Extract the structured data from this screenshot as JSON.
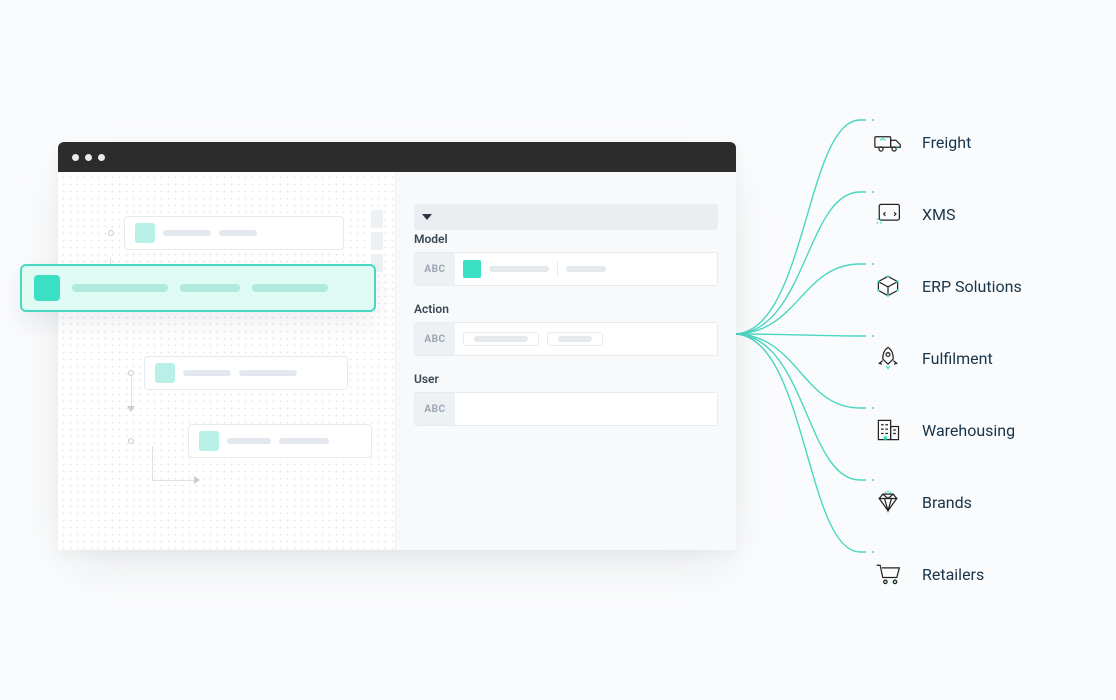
{
  "form": {
    "field1_label": "Model",
    "field2_label": "Action",
    "field3_label": "User",
    "type_badge": "ABC"
  },
  "destinations": [
    {
      "label": "Freight"
    },
    {
      "label": "XMS"
    },
    {
      "label": "ERP Solutions"
    },
    {
      "label": "Fulfilment"
    },
    {
      "label": "Warehousing"
    },
    {
      "label": "Brands"
    },
    {
      "label": "Retailers"
    }
  ],
  "colors": {
    "accent": "#3be0c4",
    "stroke": "#4cd6c2",
    "ink": "#18344a"
  }
}
